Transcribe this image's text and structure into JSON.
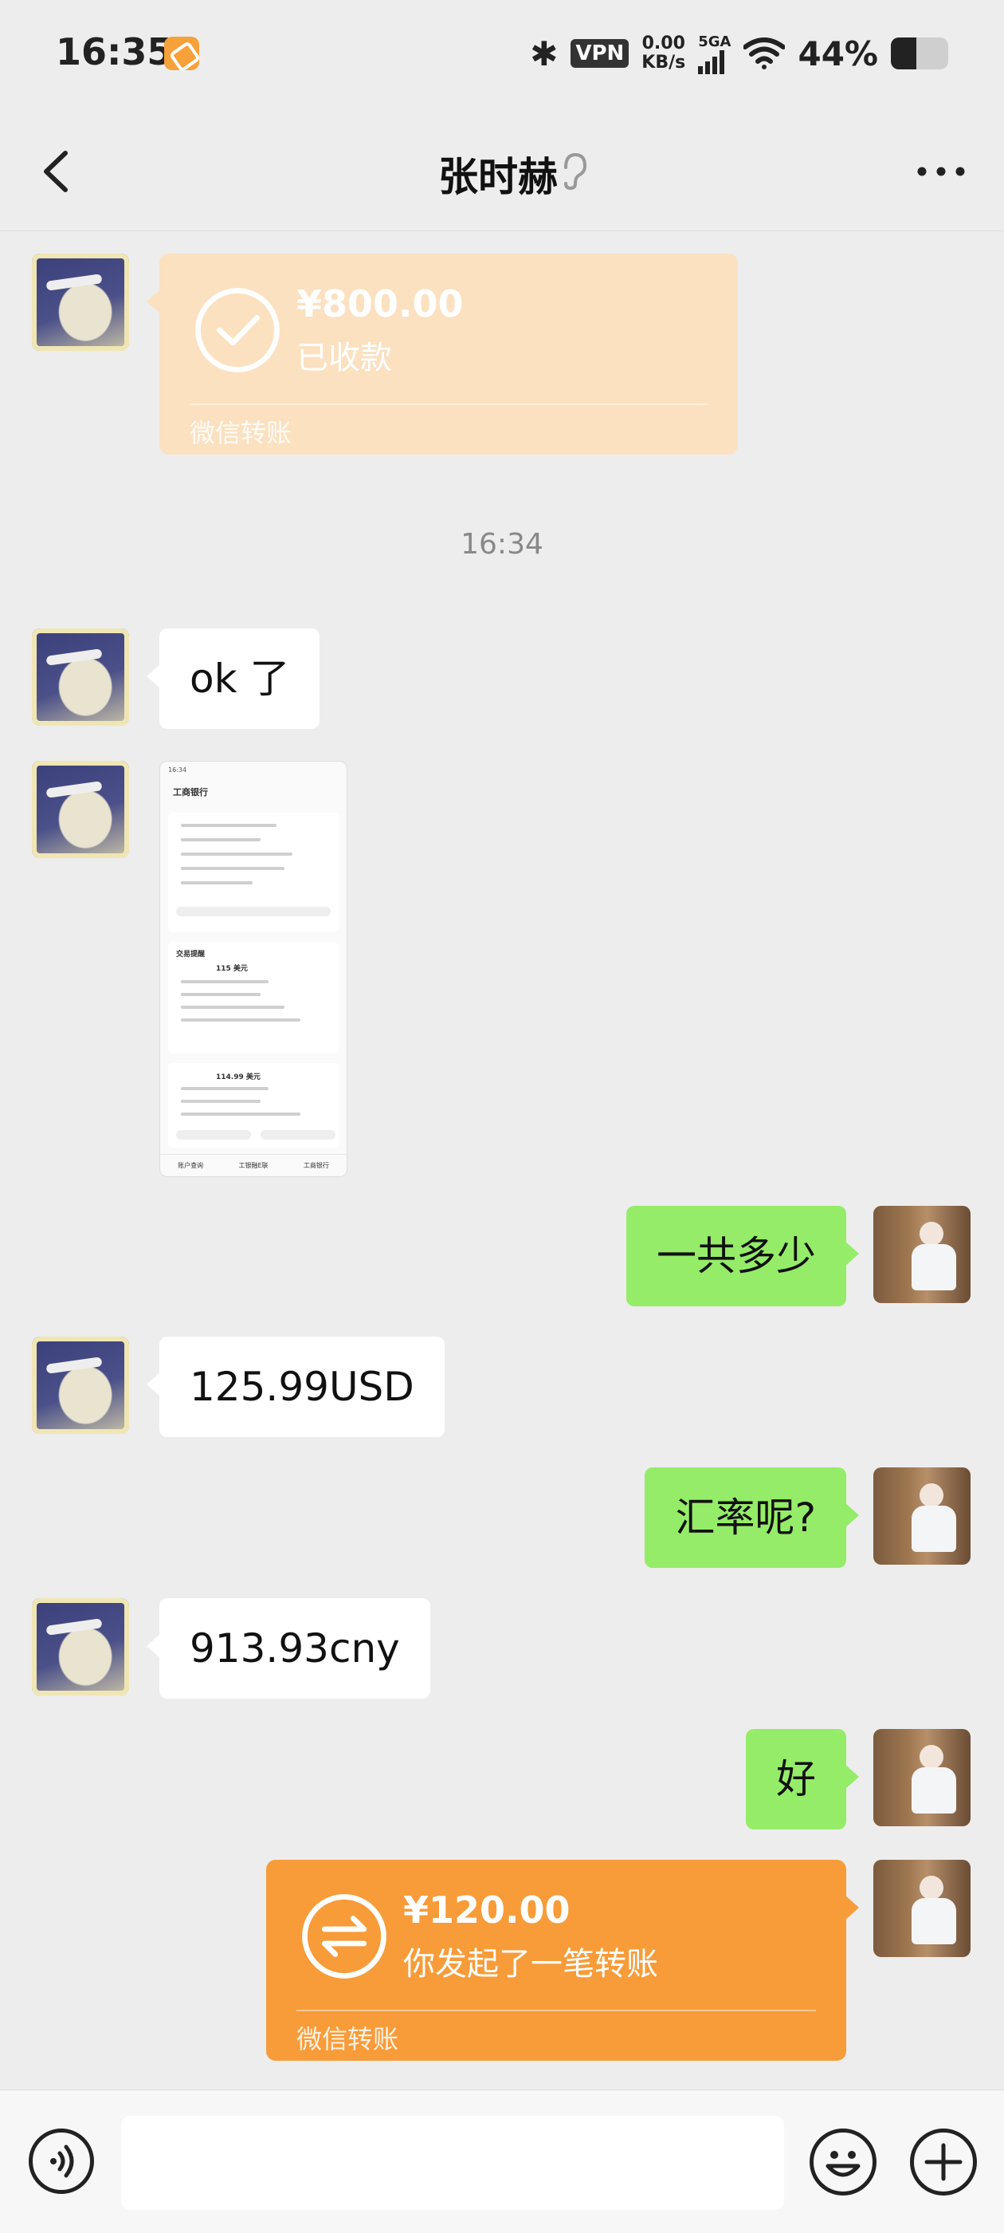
{
  "status_bar": {
    "time": "16:35",
    "vpn_label": "VPN",
    "speed_value": "0.00",
    "speed_unit": "KB/s",
    "network": "5GA",
    "battery_percent": "44%",
    "battery_level": 0.44,
    "icons": [
      "app-notification-icon",
      "bluetooth-icon",
      "signal-icon",
      "wifi-icon",
      "battery-icon"
    ]
  },
  "nav": {
    "title": "张时赫",
    "icons": [
      "back-icon",
      "ear-icon",
      "more-icon"
    ]
  },
  "messages": {
    "transfer_received": {
      "amount": "¥800.00",
      "status": "已收款",
      "footer": "微信转账"
    },
    "timestamp": "16:34",
    "msg1": "ok 了",
    "screenshot": {
      "title": "工商银行",
      "section_label": "交易提醒",
      "amount_1": "115 美元",
      "amount_2": "114.99 美元",
      "nav_items": [
        "账户查询",
        "工银融E联",
        "工商银行"
      ]
    },
    "msg2": "一共多少",
    "msg3": "125.99USD",
    "msg4": "汇率呢?",
    "msg5": "913.93cny",
    "msg6": "好",
    "transfer_sent": {
      "amount": "¥120.00",
      "status": "你发起了一笔转账",
      "footer": "微信转账"
    }
  },
  "input": {
    "value": "",
    "icons": [
      "voice-icon",
      "emoji-icon",
      "plus-icon"
    ]
  },
  "colors": {
    "background": "#ededed",
    "my_bubble": "#95ec69",
    "their_bubble": "#ffffff",
    "transfer_received": "#fbe1c0",
    "transfer_sent": "#f79c39"
  }
}
